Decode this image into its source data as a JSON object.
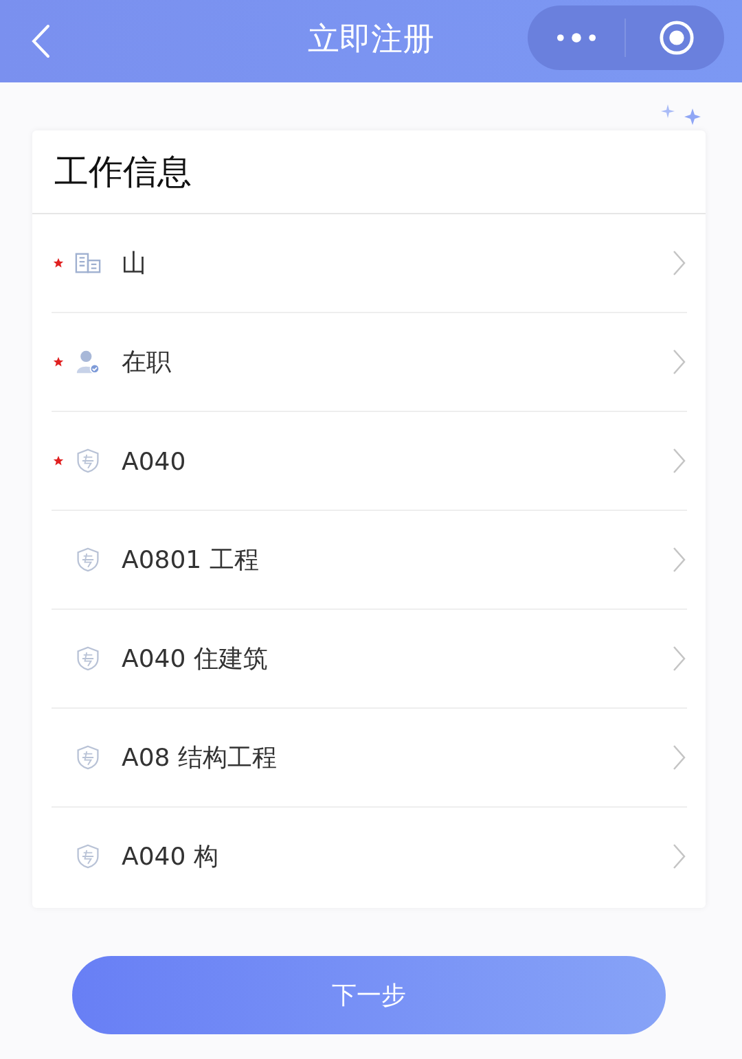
{
  "nav_bar": {
    "title": "立即注册"
  },
  "card": {
    "title": "工作信息",
    "rows": [
      {
        "kind": "building",
        "required": true,
        "value": "山"
      },
      {
        "kind": "person",
        "required": true,
        "value": "在职"
      },
      {
        "kind": "badge",
        "required": true,
        "value": "A040"
      },
      {
        "kind": "badge",
        "required": false,
        "value": "A0801 工程"
      },
      {
        "kind": "badge",
        "required": false,
        "value": "A040 住建筑"
      },
      {
        "kind": "badge",
        "required": false,
        "value": "A08 结构工程"
      },
      {
        "kind": "badge",
        "required": false,
        "value": "A040 构"
      }
    ]
  },
  "next_button": "下一步"
}
